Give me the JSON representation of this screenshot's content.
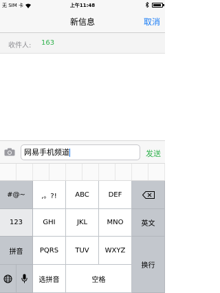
{
  "status_bar": {
    "carrier": "无 SIM 卡",
    "time": "上午11:48"
  },
  "nav": {
    "title": "新信息",
    "cancel": "取消"
  },
  "recipient": {
    "label": "收件人:",
    "value": "163"
  },
  "composer": {
    "text": "网易手机频道",
    "send": "发送"
  },
  "keyboard": {
    "rows": [
      [
        "#@~",
        ",。?!",
        "ABC",
        "DEF",
        "delete-icon"
      ],
      [
        "123",
        "GHI",
        "JKL",
        "MNO",
        "英文"
      ],
      [
        "拼音",
        "PQRS",
        "TUV",
        "WXYZ",
        "换行"
      ],
      [
        "globe-icon",
        "mic-icon",
        "选拼音",
        "空格"
      ]
    ],
    "labels": {
      "k_sym": "#@~",
      "k_punct": ",。?!",
      "k_abc": "ABC",
      "k_def": "DEF",
      "k_123": "123",
      "k_ghi": "GHI",
      "k_jkl": "JKL",
      "k_mno": "MNO",
      "k_english": "英文",
      "k_pinyin": "拼音",
      "k_pqrs": "PQRS",
      "k_tuv": "TUV",
      "k_wxyz": "WXYZ",
      "k_return": "换行",
      "k_select_pinyin": "选拼音",
      "k_space": "空格"
    }
  },
  "colors": {
    "accent_blue": "#1a7cf5",
    "green": "#2fb24c"
  }
}
